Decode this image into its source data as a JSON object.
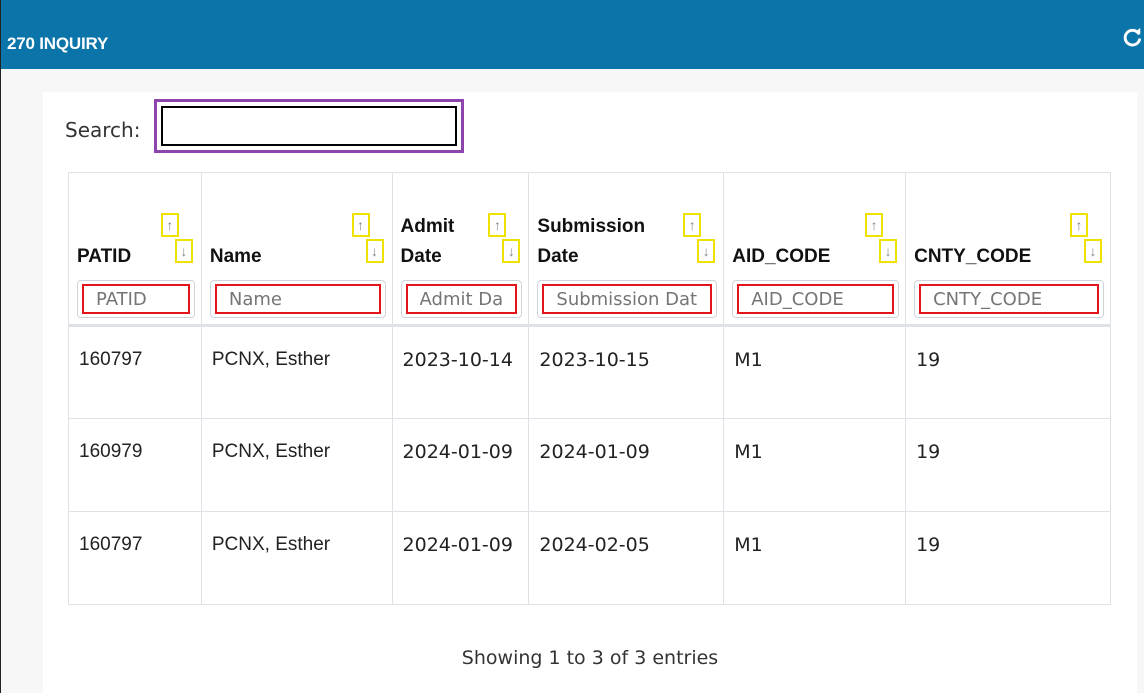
{
  "header": {
    "title": "270 INQUIRY",
    "refresh_icon": "refresh-icon"
  },
  "search": {
    "label": "Search:",
    "value": ""
  },
  "table": {
    "columns": [
      {
        "key": "patid",
        "label": "PATID",
        "filter_placeholder": "PATID"
      },
      {
        "key": "name",
        "label": "Name",
        "filter_placeholder": "Name"
      },
      {
        "key": "admit_date",
        "label": "Admit Date",
        "filter_placeholder": "Admit Date"
      },
      {
        "key": "submission_date",
        "label": "Submission Date",
        "filter_placeholder": "Submission Date"
      },
      {
        "key": "aid_code",
        "label": "AID_CODE",
        "filter_placeholder": "AID_CODE"
      },
      {
        "key": "cnty_code",
        "label": "CNTY_CODE",
        "filter_placeholder": "CNTY_CODE"
      }
    ],
    "sort_icons": {
      "up": "↑",
      "down": "↓"
    },
    "rows": [
      [
        "160797",
        "PCNX, Esther",
        "2023-10-14",
        "2023-10-15",
        "M1",
        "19"
      ],
      [
        "160979",
        "PCNX, Esther",
        "2024-01-09",
        "2024-01-09",
        "M1",
        "19"
      ],
      [
        "160797",
        "PCNX, Esther",
        "2024-01-09",
        "2024-02-05",
        "M1",
        "19"
      ]
    ]
  },
  "footer": {
    "info": "Showing 1 to 3 of 3 entries"
  },
  "colors": {
    "header_bg": "#0b74a9",
    "filter_border": "#e3141b",
    "search_outline": "#8e44ad",
    "sort_highlight": "#f0e200"
  }
}
